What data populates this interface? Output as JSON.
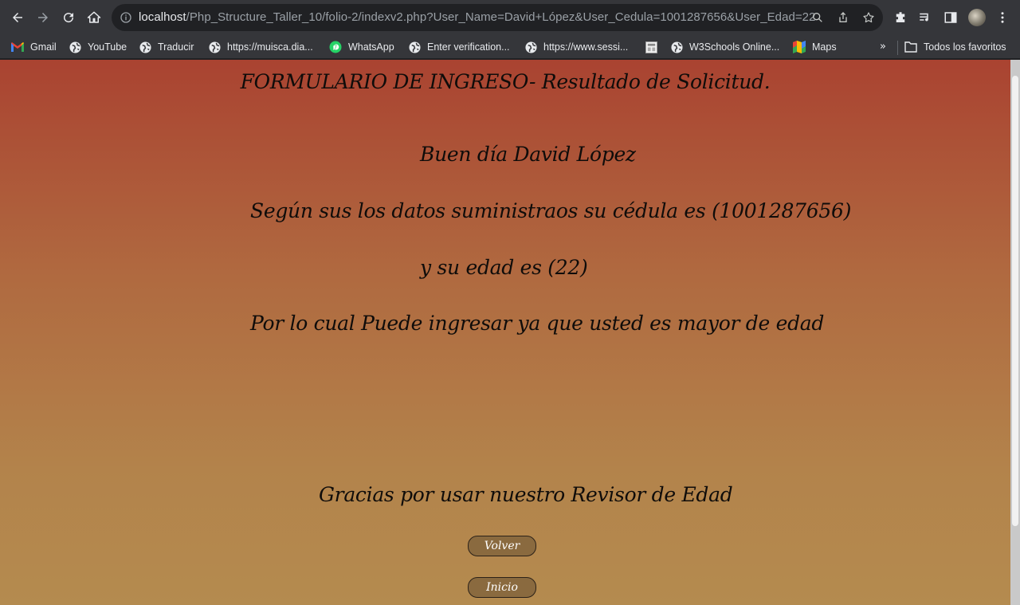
{
  "browser": {
    "url_host": "localhost",
    "url_path": "/Php_Structure_Taller_10/folio-2/indexv2.php?User_Name=David+López&User_Cedula=1001287656&User_Edad=22"
  },
  "bookmarks": {
    "items": [
      {
        "label": "Gmail",
        "icon": "gmail-icon"
      },
      {
        "label": "YouTube",
        "icon": "globe-icon"
      },
      {
        "label": "Traducir",
        "icon": "globe-icon"
      },
      {
        "label": "https://muisca.dia...",
        "icon": "globe-icon"
      },
      {
        "label": "WhatsApp",
        "icon": "whatsapp-icon"
      },
      {
        "label": "Enter verification...",
        "icon": "globe-icon"
      },
      {
        "label": "https://www.sessi...",
        "icon": "globe-icon"
      },
      {
        "label": "",
        "icon": "page-thumbnail-icon"
      },
      {
        "label": "W3Schools Online...",
        "icon": "globe-icon"
      },
      {
        "label": "Maps",
        "icon": "maps-icon"
      }
    ],
    "more": "»",
    "all_bookmarks": "Todos los favoritos"
  },
  "page": {
    "title": "FORMULARIO DE INGRESO- Resultado de Solicitud.",
    "greeting": "Buen día David López",
    "cedula_line": "Según sus los datos suministraos su cédula es (1001287656)",
    "edad_line": "y su edad es (22)",
    "result_line": "Por lo cual Puede ingresar ya que usted es mayor de edad",
    "thanks_line": "Gracias por usar nuestro Revisor de Edad",
    "buttons": {
      "volver": "Volver",
      "inicio": "Inicio"
    }
  },
  "colors": {
    "page_top": "#aa4331",
    "page_bottom": "#b48b4f",
    "button_bg": "#8a6a3f",
    "chrome_bg": "#35363a"
  }
}
